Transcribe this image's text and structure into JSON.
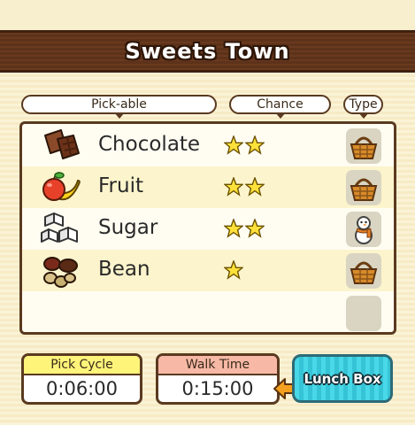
{
  "header": {
    "title": "Sweets Town"
  },
  "columns": {
    "pickable": "Pick-able",
    "chance": "Chance",
    "type": "Type"
  },
  "items": [
    {
      "name": "Chocolate",
      "stars": 2,
      "icon": "chocolate-icon",
      "type_icon": "basket-icon"
    },
    {
      "name": "Fruit",
      "stars": 2,
      "icon": "fruit-icon",
      "type_icon": "basket-icon"
    },
    {
      "name": "Sugar",
      "stars": 2,
      "icon": "sugar-cubes-icon",
      "type_icon": "snowman-icon"
    },
    {
      "name": "Bean",
      "stars": 1,
      "icon": "beans-icon",
      "type_icon": "basket-icon"
    }
  ],
  "pick_cycle": {
    "label": "Pick Cycle",
    "value": "0:06:00"
  },
  "walk_time": {
    "label": "Walk Time",
    "value": "0:15:00"
  },
  "lunch_box": {
    "label": "Lunch Box"
  },
  "colors": {
    "title_bar": "#5d321a",
    "row_alt": "#fcf4cc",
    "pick_cycle_label": "#fff47a",
    "walk_time_label": "#f7b9a6",
    "lunch_button": "#48d8e8",
    "star": "#ffe13a"
  }
}
